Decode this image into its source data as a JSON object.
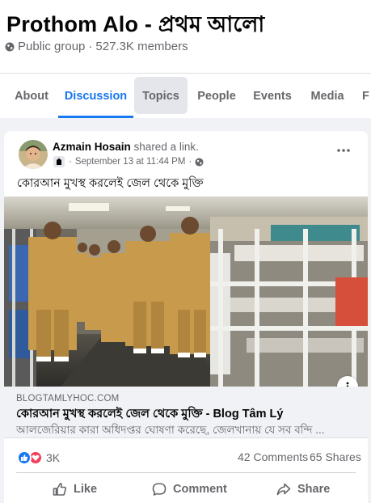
{
  "group": {
    "title": "Prothom Alo - প্রথম আলো",
    "privacy": "Public group",
    "separator": "·",
    "members": "527.3K members"
  },
  "tabs": [
    {
      "label": "About"
    },
    {
      "label": "Discussion"
    },
    {
      "label": "Topics"
    },
    {
      "label": "People"
    },
    {
      "label": "Events"
    },
    {
      "label": "Media"
    },
    {
      "label": "F"
    }
  ],
  "post": {
    "author": "Azmain Hosain",
    "action": "shared a link.",
    "separator": "·",
    "date": "September 13 at 11:44 PM",
    "dot": "·",
    "text": "কোরআন মুখস্থ করলেই জেল থেকে মুক্তি",
    "link": {
      "domain": "BLOGTAMLYHOC.COM",
      "title": "কোরআন মুখস্থ করলেই জেল থেকে মুক্তি - Blog Tâm Lý",
      "description": "আলজেরিয়ার কারা অধিদপ্তর ঘোষণা করেছে, জেলখানায় যে সব বন্দি ..."
    },
    "reactions_count": "3K",
    "comments": "42 Comments",
    "shares": "65 Shares",
    "actions": {
      "like": "Like",
      "comment": "Comment",
      "share": "Share"
    }
  },
  "colors": {
    "accent": "#1877f2",
    "love": "#f33e58",
    "secondary_text": "#65676b",
    "background": "#f0f2f5"
  },
  "icons": [
    "globe-icon",
    "group-badge-icon",
    "more-options-icon",
    "info-icon",
    "like-reaction-icon",
    "love-reaction-icon",
    "like-icon",
    "comment-icon",
    "share-icon"
  ]
}
